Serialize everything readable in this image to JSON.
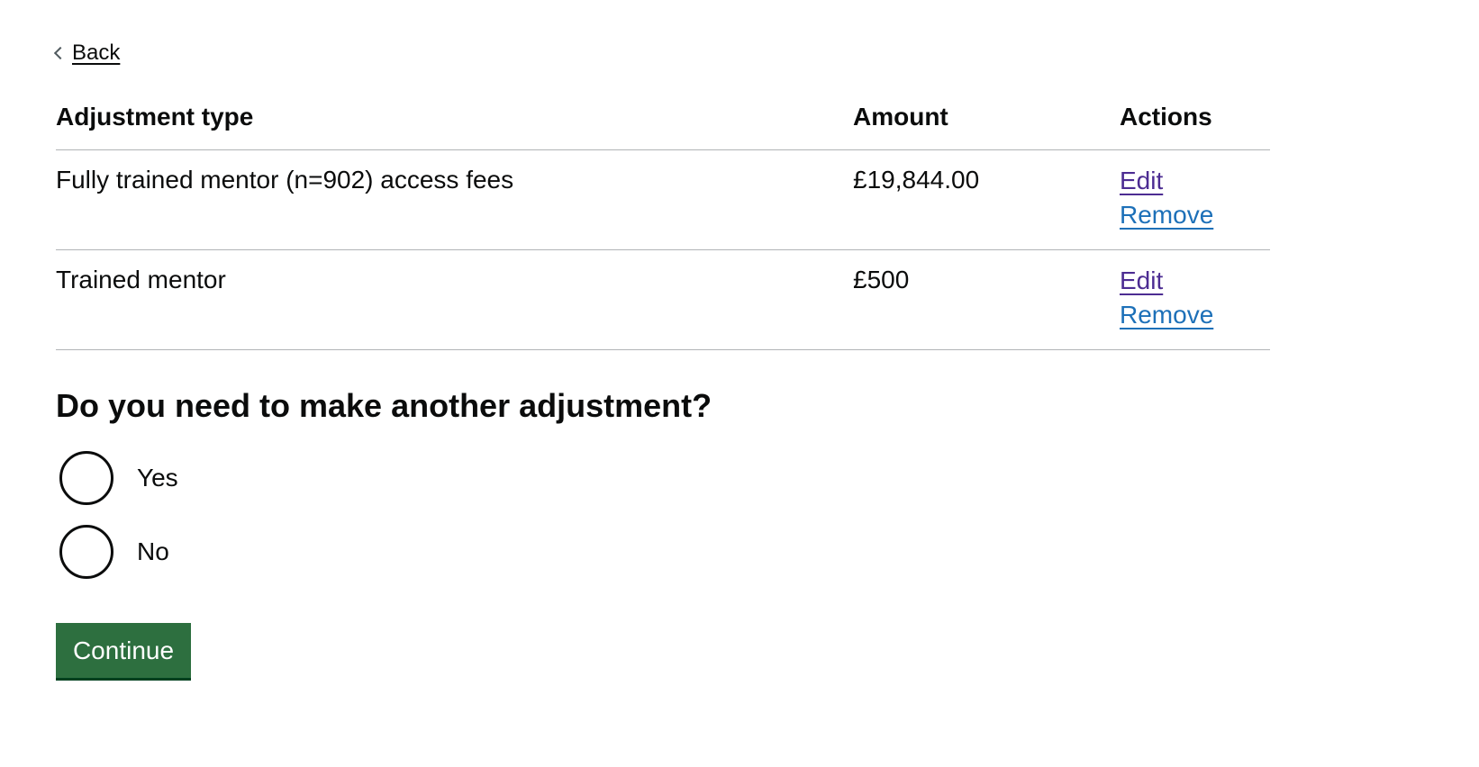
{
  "nav": {
    "back_label": "Back"
  },
  "table": {
    "headers": {
      "type": "Adjustment type",
      "amount": "Amount",
      "actions": "Actions"
    },
    "rows": [
      {
        "type": "Fully trained mentor (n=902) access fees",
        "amount": "£19,844.00",
        "edit_label": "Edit",
        "remove_label": "Remove"
      },
      {
        "type": "Trained mentor",
        "amount": "£500",
        "edit_label": "Edit",
        "remove_label": "Remove"
      }
    ]
  },
  "question": {
    "title": "Do you need to make another adjustment?",
    "options": [
      {
        "label": "Yes",
        "selected": false
      },
      {
        "label": "No",
        "selected": false
      }
    ]
  },
  "actions": {
    "continue_label": "Continue"
  },
  "colors": {
    "text": "#0b0c0c",
    "link_visited": "#4c2c92",
    "link": "#1d70b8",
    "button": "#2d6f3f",
    "button_shadow": "#00401e",
    "border": "#b1b4b6"
  },
  "icons": {
    "back": "chevron-left-icon"
  }
}
